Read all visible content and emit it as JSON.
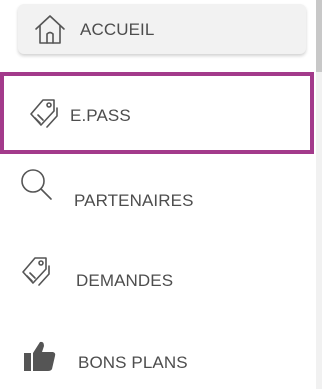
{
  "menu": {
    "items": [
      {
        "label": "ACCUEIL",
        "icon": "home-icon"
      },
      {
        "label": "E.PASS",
        "icon": "tag-icon",
        "active": true
      },
      {
        "label": "PARTENAIRES",
        "icon": "search-icon"
      },
      {
        "label": "DEMANDES",
        "icon": "tag-icon"
      },
      {
        "label": "BONS PLANS",
        "icon": "thumbs-up-icon"
      }
    ]
  },
  "colors": {
    "active_border": "#a33a8b",
    "text": "#4d4d4d",
    "icon_stroke": "#555555"
  }
}
